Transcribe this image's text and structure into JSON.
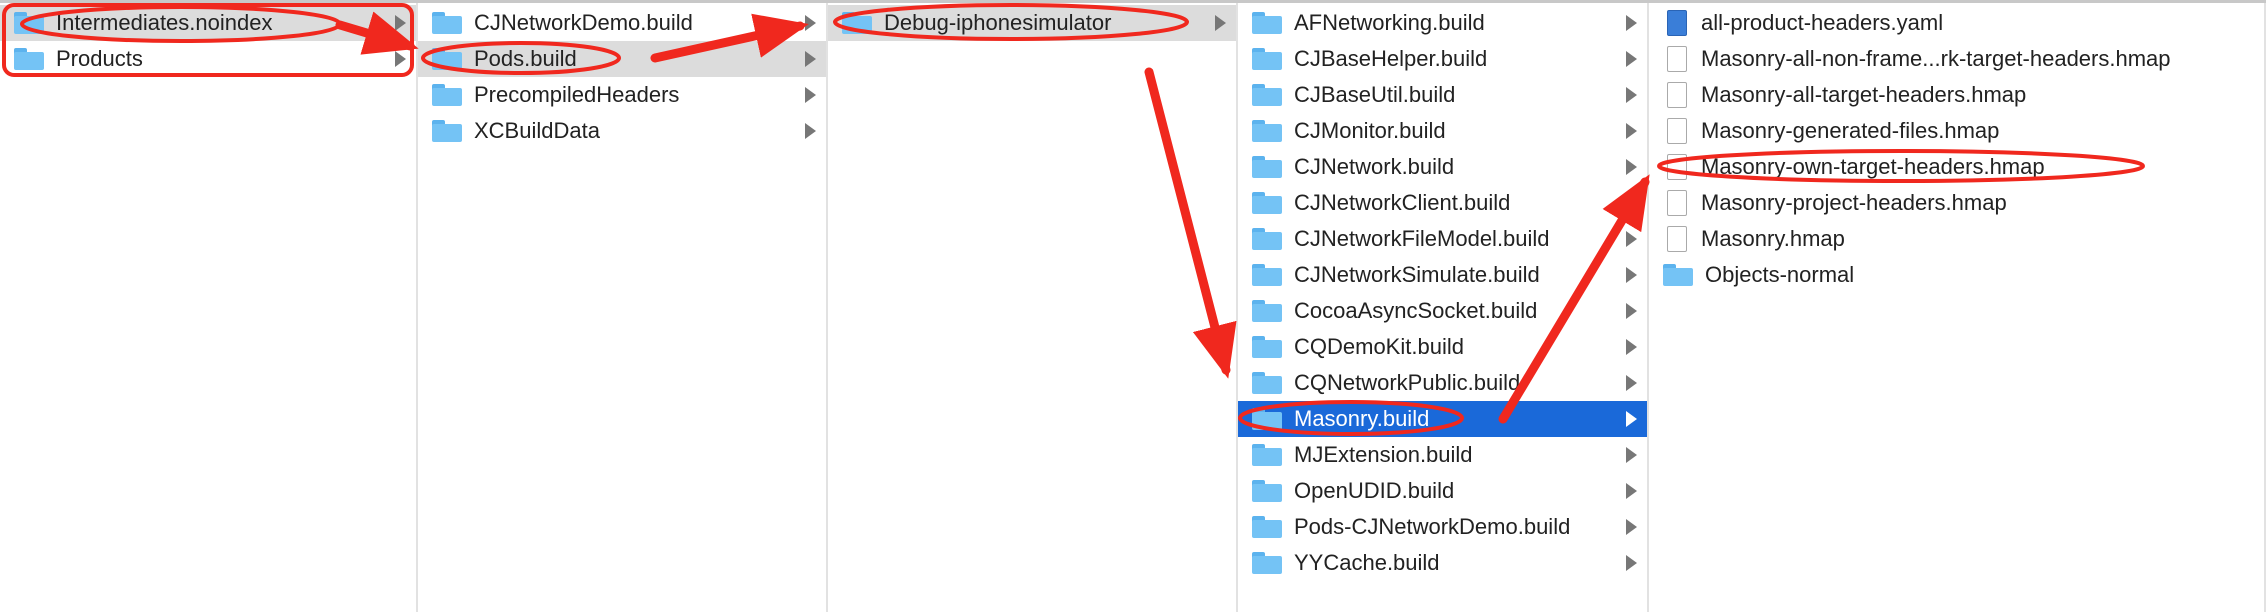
{
  "columns": [
    {
      "items": [
        {
          "label": "Intermediates.noindex",
          "type": "folder",
          "state": "selected",
          "chevron": true
        },
        {
          "label": "Products",
          "type": "folder",
          "chevron": true
        }
      ]
    },
    {
      "items": [
        {
          "label": "CJNetworkDemo.build",
          "type": "folder",
          "chevron": true
        },
        {
          "label": "Pods.build",
          "type": "folder",
          "state": "selected",
          "chevron": true
        },
        {
          "label": "PrecompiledHeaders",
          "type": "folder",
          "chevron": true
        },
        {
          "label": "XCBuildData",
          "type": "folder",
          "chevron": true
        }
      ]
    },
    {
      "items": [
        {
          "label": "Debug-iphonesimulator",
          "type": "folder",
          "state": "selected",
          "chevron": true
        }
      ]
    },
    {
      "items": [
        {
          "label": "AFNetworking.build",
          "type": "folder",
          "chevron": true
        },
        {
          "label": "CJBaseHelper.build",
          "type": "folder",
          "chevron": true
        },
        {
          "label": "CJBaseUtil.build",
          "type": "folder",
          "chevron": true
        },
        {
          "label": "CJMonitor.build",
          "type": "folder",
          "chevron": true
        },
        {
          "label": "CJNetwork.build",
          "type": "folder",
          "chevron": true
        },
        {
          "label": "CJNetworkClient.build",
          "type": "folder",
          "chevron": true
        },
        {
          "label": "CJNetworkFileModel.build",
          "type": "folder",
          "chevron": true
        },
        {
          "label": "CJNetworkSimulate.build",
          "type": "folder",
          "chevron": true
        },
        {
          "label": "CocoaAsyncSocket.build",
          "type": "folder",
          "chevron": true
        },
        {
          "label": "CQDemoKit.build",
          "type": "folder",
          "chevron": true
        },
        {
          "label": "CQNetworkPublic.build",
          "type": "folder",
          "chevron": true
        },
        {
          "label": "Masonry.build",
          "type": "folder",
          "state": "active",
          "chevron": true
        },
        {
          "label": "MJExtension.build",
          "type": "folder",
          "chevron": true
        },
        {
          "label": "OpenUDID.build",
          "type": "folder",
          "chevron": true
        },
        {
          "label": "Pods-CJNetworkDemo.build",
          "type": "folder",
          "chevron": true
        },
        {
          "label": "YYCache.build",
          "type": "folder",
          "chevron": true
        }
      ]
    },
    {
      "items": [
        {
          "label": "all-product-headers.yaml",
          "type": "yaml"
        },
        {
          "label": "Masonry-all-non-frame...rk-target-headers.hmap",
          "type": "file"
        },
        {
          "label": "Masonry-all-target-headers.hmap",
          "type": "file"
        },
        {
          "label": "Masonry-generated-files.hmap",
          "type": "file"
        },
        {
          "label": "Masonry-own-target-headers.hmap",
          "type": "file"
        },
        {
          "label": "Masonry-project-headers.hmap",
          "type": "file"
        },
        {
          "label": "Masonry.hmap",
          "type": "file"
        },
        {
          "label": "Objects-normal",
          "type": "folder"
        }
      ]
    }
  ],
  "colors": {
    "selection": "#dcdcdc",
    "active": "#1a69d9",
    "annotation": "#f0281e"
  }
}
